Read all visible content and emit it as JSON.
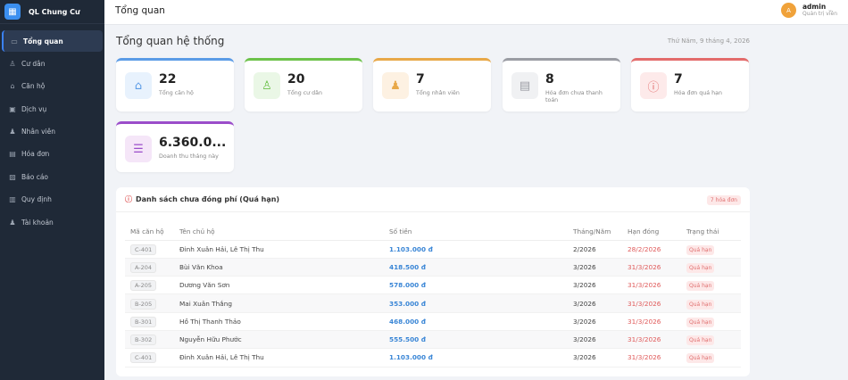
{
  "brand": {
    "name": "QL Chung Cư"
  },
  "sidebar": {
    "items": [
      {
        "label": "Tổng quan",
        "icon": "dashboard-icon",
        "glyph": "▭",
        "active": true
      },
      {
        "label": "Cư dân",
        "icon": "user-icon",
        "glyph": "♙"
      },
      {
        "label": "Căn hộ",
        "icon": "home-icon",
        "glyph": "⌂"
      },
      {
        "label": "Dịch vụ",
        "icon": "service-icon",
        "glyph": "▣"
      },
      {
        "label": "Nhân viên",
        "icon": "staff-icon",
        "glyph": "♟"
      },
      {
        "label": "Hóa đơn",
        "icon": "invoice-icon",
        "glyph": "▤"
      },
      {
        "label": "Báo cáo",
        "icon": "chart-icon",
        "glyph": "▨"
      },
      {
        "label": "Quy định",
        "icon": "book-icon",
        "glyph": "▥"
      },
      {
        "label": "Tài khoản",
        "icon": "account-icon",
        "glyph": "♟"
      }
    ]
  },
  "header": {
    "title": "Tổng quan",
    "user": {
      "initial": "A",
      "name": "admin",
      "role": "Quản trị viên"
    }
  },
  "page": {
    "title": "Tổng quan hệ thống",
    "date": "Thứ Năm, 9 tháng 4, 2026"
  },
  "stats": [
    {
      "value": "22",
      "label": "Tổng căn hộ",
      "icon": "home-icon",
      "glyph": "⌂",
      "color": "#5b9be6",
      "bg": "#e8f2fd"
    },
    {
      "value": "20",
      "label": "Tổng cư dân",
      "icon": "user-icon",
      "glyph": "♙",
      "color": "#6cc24a",
      "bg": "#eaf7e6"
    },
    {
      "value": "7",
      "label": "Tổng nhân viên",
      "icon": "staff-icon",
      "glyph": "♟",
      "color": "#e8a848",
      "bg": "#fdf1e2"
    },
    {
      "value": "8",
      "label": "Hóa đơn chưa thanh toán",
      "icon": "document-icon",
      "glyph": "▤",
      "color": "#9a9ca3",
      "bg": "#f0f1f3"
    },
    {
      "value": "7",
      "label": "Hóa đơn quá hạn",
      "icon": "alert-icon",
      "glyph": "ⓘ",
      "color": "#e36b6b",
      "bg": "#fdeaea"
    },
    {
      "value": "6.360.0...",
      "label": "Doanh thu tháng này",
      "icon": "database-icon",
      "glyph": "☰",
      "color": "#9b4dca",
      "bg": "#f5e6f8"
    }
  ],
  "overdue": {
    "title": "Danh sách chưa đóng phí (Quá hạn)",
    "badge": "7 hóa đơn",
    "columns": [
      "Mã căn hộ",
      "Tên chủ hộ",
      "Số tiền",
      "Tháng/Năm",
      "Hạn đóng",
      "Trạng thái"
    ],
    "rows": [
      [
        "C-401",
        "Đinh Xuân Hải, Lê Thị Thu",
        "1.103.000 đ",
        "2/2026",
        "28/2/2026",
        "Quá hạn"
      ],
      [
        "A-204",
        "Bùi Văn Khoa",
        "418.500 đ",
        "3/2026",
        "31/3/2026",
        "Quá hạn"
      ],
      [
        "A-205",
        "Dương Văn Sơn",
        "578.000 đ",
        "3/2026",
        "31/3/2026",
        "Quá hạn"
      ],
      [
        "B-205",
        "Mai Xuân Thắng",
        "353.000 đ",
        "3/2026",
        "31/3/2026",
        "Quá hạn"
      ],
      [
        "B-301",
        "Hồ Thị Thanh Thảo",
        "468.000 đ",
        "3/2026",
        "31/3/2026",
        "Quá hạn"
      ],
      [
        "B-302",
        "Nguyễn Hữu Phước",
        "555.500 đ",
        "3/2026",
        "31/3/2026",
        "Quá hạn"
      ],
      [
        "C-401",
        "Đinh Xuân Hải, Lê Thị Thu",
        "1.103.000 đ",
        "3/2026",
        "31/3/2026",
        "Quá hạn"
      ]
    ]
  }
}
